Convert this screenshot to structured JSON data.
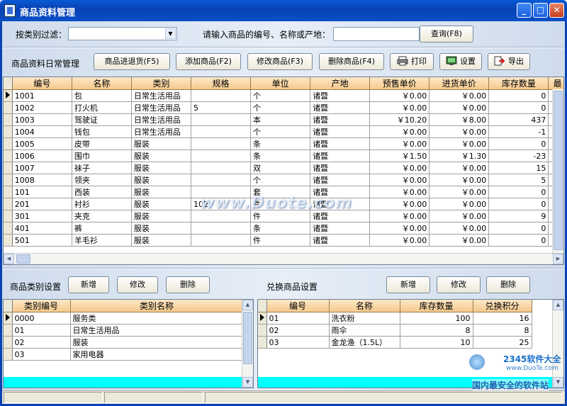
{
  "window": {
    "title": "商品资料管理"
  },
  "filter": {
    "category_label": "按类别过滤：",
    "category_value": "",
    "search_label": "请输入商品的编号、名称或产地：",
    "search_value": "",
    "query_button": "查询(F8)"
  },
  "toolbar": {
    "section_label": "商品资料日常管理",
    "buttons": [
      "商品进退货(F5)",
      "添加商品(F2)",
      "修改商品(F3)",
      "删除商品(F4)",
      "打印",
      "设置",
      "导出"
    ]
  },
  "products": {
    "headers": [
      "编号",
      "名称",
      "类别",
      "规格",
      "单位",
      "产地",
      "预售单价",
      "进货单价",
      "库存数量",
      "最"
    ],
    "rows": [
      [
        "1001",
        "包",
        "日常生活用品",
        "",
        "个",
        "诸暨",
        "￥0.00",
        "￥0.00",
        "0"
      ],
      [
        "1002",
        "打火机",
        "日常生活用品",
        "5",
        "个",
        "诸暨",
        "￥0.00",
        "￥0.00",
        "0"
      ],
      [
        "1003",
        "驾驶证",
        "日常生活用品",
        "",
        "本",
        "诸暨",
        "￥10.20",
        "￥8.00",
        "437"
      ],
      [
        "1004",
        "钱包",
        "日常生活用品",
        "",
        "个",
        "诸暨",
        "￥0.00",
        "￥0.00",
        "-1"
      ],
      [
        "1005",
        "皮带",
        "服装",
        "",
        "条",
        "诸暨",
        "￥0.00",
        "￥0.00",
        "0"
      ],
      [
        "1006",
        "围巾",
        "服装",
        "",
        "条",
        "诸暨",
        "￥1.50",
        "￥1.30",
        "-23"
      ],
      [
        "1007",
        "袜子",
        "服装",
        "",
        "双",
        "诸暨",
        "￥0.00",
        "￥0.00",
        "15"
      ],
      [
        "1008",
        "领夹",
        "服装",
        "",
        "个",
        "诸暨",
        "￥0.00",
        "￥0.00",
        "5"
      ],
      [
        "101",
        "西装",
        "服装",
        "",
        "套",
        "诸暨",
        "￥0.00",
        "￥0.00",
        "0"
      ],
      [
        "201",
        "衬衫",
        "服装",
        "102",
        "件",
        "诸暨",
        "￥0.00",
        "￥0.00",
        "0"
      ],
      [
        "301",
        "夹克",
        "服装",
        "",
        "件",
        "诸暨",
        "￥0.00",
        "￥0.00",
        "9"
      ],
      [
        "401",
        "裤",
        "服装",
        "",
        "条",
        "诸暨",
        "￥0.00",
        "￥0.00",
        "0"
      ],
      [
        "501",
        "羊毛衫",
        "服装",
        "",
        "件",
        "诸暨",
        "￥0.00",
        "￥0.00",
        "0"
      ]
    ]
  },
  "categories": {
    "section_label": "商品类别设置",
    "buttons": [
      "新增",
      "修改",
      "删除"
    ],
    "headers": [
      "类别编号",
      "类别名称"
    ],
    "rows": [
      [
        "0000",
        "服务类"
      ],
      [
        "01",
        "日常生活用品"
      ],
      [
        "02",
        "服装"
      ],
      [
        "03",
        "家用电器"
      ]
    ]
  },
  "exchange": {
    "section_label": "兑换商品设置",
    "buttons": [
      "新增",
      "修改",
      "删除"
    ],
    "headers": [
      "编号",
      "名称",
      "库存数量",
      "兑换积分"
    ],
    "rows": [
      [
        "01",
        "洗衣粉",
        "100",
        "16"
      ],
      [
        "02",
        "雨伞",
        "8",
        "8"
      ],
      [
        "03",
        "金龙渔（1.5L）",
        "10",
        "25"
      ]
    ]
  },
  "watermark": {
    "center": "www.Duote.com",
    "corner_brand": "2345软件大全",
    "corner_url": "www.DuoTe.com",
    "corner_text": "国内最安全的软件站"
  },
  "colors": {
    "titlebar": "#0842b4",
    "header": "#f5c98c",
    "cyan": "#00ffff"
  }
}
